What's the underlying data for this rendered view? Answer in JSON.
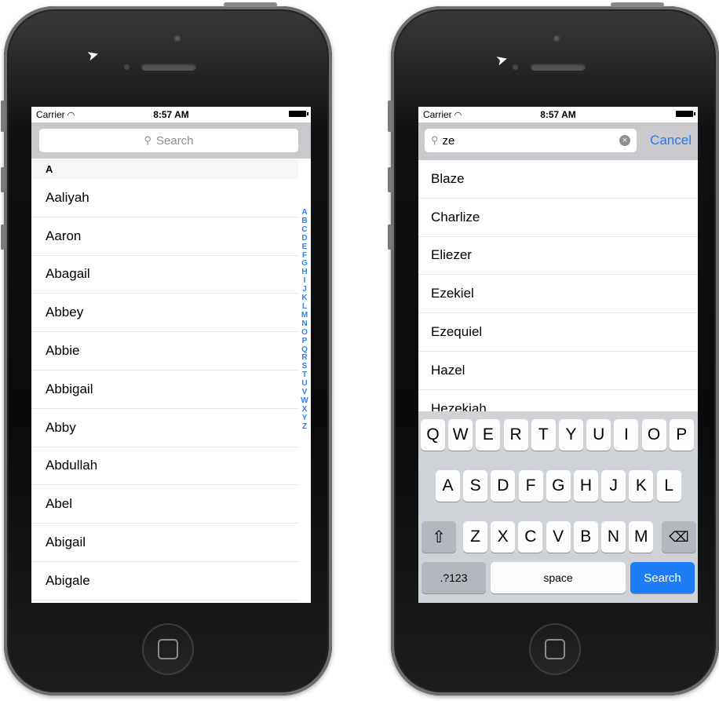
{
  "status": {
    "carrier": "Carrier",
    "time": "8:57 AM",
    "wifi_icon": "wifi-icon",
    "battery_icon": "battery-icon"
  },
  "left_phone": {
    "search_placeholder": "Search",
    "section_header": "A",
    "names": [
      "Aaliyah",
      "Aaron",
      "Abagail",
      "Abbey",
      "Abbie",
      "Abbigail",
      "Abby",
      "Abdullah",
      "Abel",
      "Abigail",
      "Abigale"
    ],
    "index_letters": [
      "A",
      "B",
      "C",
      "D",
      "E",
      "F",
      "G",
      "H",
      "I",
      "J",
      "K",
      "L",
      "M",
      "N",
      "O",
      "P",
      "Q",
      "R",
      "S",
      "T",
      "U",
      "V",
      "W",
      "X",
      "Y",
      "Z"
    ]
  },
  "right_phone": {
    "search_query": "ze",
    "cancel_label": "Cancel",
    "results": [
      "Blaze",
      "Charlize",
      "Eliezer",
      "Ezekiel",
      "Ezequiel",
      "Hazel",
      "Hezekiah"
    ],
    "keyboard": {
      "row1": [
        "Q",
        "W",
        "E",
        "R",
        "T",
        "Y",
        "U",
        "I",
        "O",
        "P"
      ],
      "row2": [
        "A",
        "S",
        "D",
        "F",
        "G",
        "H",
        "J",
        "K",
        "L"
      ],
      "row3": [
        "Z",
        "X",
        "C",
        "V",
        "B",
        "N",
        "M"
      ],
      "numbers_label": ".?123",
      "space_label": "space",
      "search_label": "Search"
    }
  },
  "accent_color": "#1e7cf6"
}
